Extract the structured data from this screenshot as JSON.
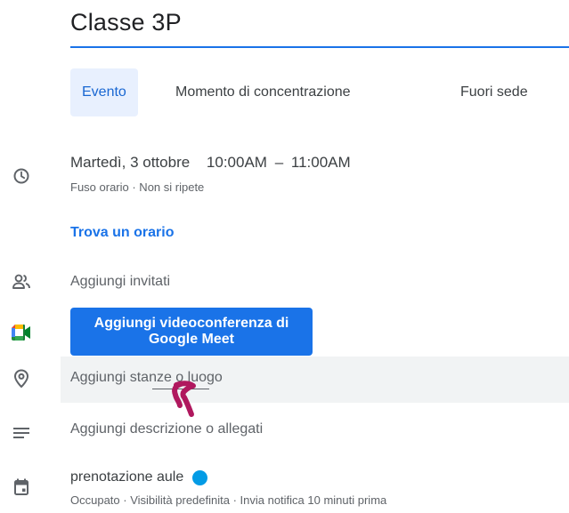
{
  "title": "Classe 3P",
  "tabs": [
    {
      "label": "Evento",
      "active": true
    },
    {
      "label": "Momento di concentrazione",
      "active": false
    },
    {
      "label": "Fuori sede",
      "active": false
    }
  ],
  "datetime": {
    "date": "Martedì, 3 ottobre",
    "start": "10:00AM",
    "separator": "–",
    "end": "11:00AM",
    "subtitle": "Fuso orario · Non si ripete"
  },
  "find_time_label": "Trova un orario",
  "guests_placeholder": "Aggiungi invitati",
  "meet_button_label": "Aggiungi videoconferenza di Google Meet",
  "location_placeholder": "Aggiungi stanze o luogo",
  "description_placeholder": "Aggiungi descrizione o allegati",
  "calendar": {
    "name": "prenotazione aule",
    "color": "#039be5",
    "details": "Occupato · Visibilità predefinita · Invia notifica 10 minuti prima"
  },
  "icons": {
    "time": "clock-icon",
    "guests": "people-icon",
    "meet": "google-meet-icon",
    "location": "map-pin-icon",
    "description": "notes-icon",
    "calendar": "calendar-icon"
  },
  "colors": {
    "accent": "#1a73e8",
    "annotation": "#b0185e"
  }
}
